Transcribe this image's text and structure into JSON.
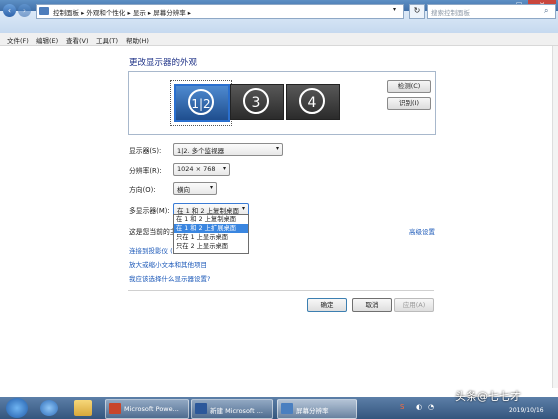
{
  "window": {
    "title": "",
    "controls": {
      "minimize": "–",
      "maximize": "□",
      "close": "✕"
    }
  },
  "address_bar": {
    "crumbs": [
      "控制面板",
      "外观和个性化",
      "显示",
      "屏幕分辨率"
    ],
    "search_placeholder": "搜索控制面板"
  },
  "menu": [
    "文件(F)",
    "编辑(E)",
    "查看(V)",
    "工具(T)",
    "帮助(H)"
  ],
  "main": {
    "heading": "更改显示器的外观",
    "monitors": [
      "1|2",
      "3",
      "4"
    ],
    "detect_button": "检测(C)",
    "identify_button": "识别(I)",
    "display_label": "显示器(S):",
    "display_value": "1|2. 多个监视器",
    "resolution_label": "分辨率(R):",
    "resolution_value": "1024 × 768",
    "orientation_label": "方向(O):",
    "orientation_value": "横向",
    "multi_label": "多显示器(M):",
    "multi_value": "在 1 和 2 上复制桌面",
    "multi_options": [
      "在 1 和 2 上复制桌面",
      "在 1 和 2 上扩展桌面",
      "只在 1 上显示桌面",
      "只在 2 上显示桌面"
    ],
    "multi_selected_index": 1,
    "current_text": "这是您当前的主",
    "advanced_link": "高级设置",
    "links": [
      "连接到投影仪 (",
      "放大或缩小文本和其他项目",
      "我应该选择什么显示器设置?"
    ]
  },
  "buttons": {
    "ok": "确定",
    "cancel": "取消",
    "apply": "应用(A)"
  },
  "taskbar": {
    "tasks": [
      {
        "label": "Microsoft Powe...",
        "color": "#c8452a"
      },
      {
        "label": "新建 Microsoft ...",
        "color": "#2b579a"
      },
      {
        "label": "屏幕分辨率",
        "color": "#4a7fc0"
      }
    ],
    "watermark": "头条@七七才",
    "date": "2019/10/16"
  }
}
